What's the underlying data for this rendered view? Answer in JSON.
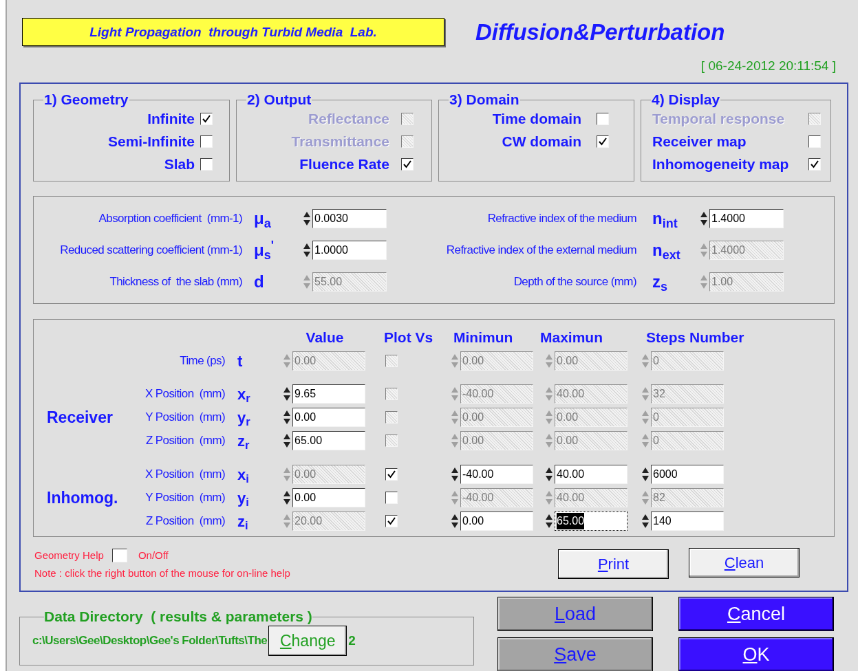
{
  "header": {
    "lab_title": "Light Propagation  through Turbid Media  Lab.",
    "app_title": "Diffusion&Perturbation",
    "timestamp": "[ 06-24-2012 20:11:54 ]"
  },
  "option_groups": [
    {
      "title": "1) Geometry",
      "items": [
        {
          "label": "Infinite",
          "checked": true,
          "disabled": false
        },
        {
          "label": "Semi-Infinite",
          "checked": false,
          "disabled": false
        },
        {
          "label": "Slab",
          "checked": false,
          "disabled": false
        }
      ]
    },
    {
      "title": "2) Output",
      "items": [
        {
          "label": "Reflectance",
          "checked": false,
          "disabled": true
        },
        {
          "label": "Transmittance",
          "checked": false,
          "disabled": true
        },
        {
          "label": "Fluence Rate",
          "checked": true,
          "disabled": false
        }
      ]
    },
    {
      "title": "3) Domain",
      "items": [
        {
          "label": "Time domain",
          "checked": false,
          "disabled": false
        },
        {
          "label": "CW domain",
          "checked": true,
          "disabled": false
        }
      ]
    },
    {
      "title": "4) Display",
      "items": [
        {
          "label": "Temporal response",
          "checked": false,
          "disabled": true
        },
        {
          "label": "Receiver map",
          "checked": false,
          "disabled": false
        },
        {
          "label": "Inhomogeneity map",
          "checked": true,
          "disabled": false
        }
      ]
    }
  ],
  "parameters": [
    {
      "label": "Absorption coefficient  (mm-1)",
      "symbol": "μ$_{a}$",
      "value": "0.0030",
      "disabled": false
    },
    {
      "label": "Refractive index of the medium",
      "symbol": "n$_{int}$",
      "value": "1.4000",
      "disabled": false
    },
    {
      "label": "Reduced scattering coefficient (mm-1)",
      "symbol": "μ$_{s}$$^{'}$",
      "value": "1.0000",
      "disabled": false
    },
    {
      "label": "Refractive index of the external medium",
      "symbol": "n$_{ext}$",
      "value": "1.4000",
      "disabled": true
    },
    {
      "label": "Thickness of  the slab (mm)",
      "symbol": "d",
      "value": "55.00",
      "disabled": true
    },
    {
      "label": "Depth of the source (mm)",
      "symbol": "z$_{s}$",
      "value": "1.00",
      "disabled": true
    }
  ],
  "table": {
    "columns": [
      "Value",
      "Plot Vs",
      "Minimun",
      "Maximun",
      "Steps Number"
    ],
    "sections": [
      {
        "rows": [
          {
            "label": "Time (ps)",
            "symbol": "t",
            "value": {
              "text": "0.00",
              "disabled": true
            },
            "plot_vs": {
              "checked": false,
              "disabled": true
            },
            "minimum": {
              "text": "0.00",
              "disabled": true
            },
            "maximum": {
              "text": "0.00",
              "disabled": true
            },
            "steps": {
              "text": "0",
              "disabled": true
            }
          }
        ]
      },
      {
        "title": "Receiver",
        "rows": [
          {
            "label": "X Position  (mm)",
            "symbol": "x$_{r}$",
            "value": {
              "text": "9.65",
              "disabled": false
            },
            "plot_vs": {
              "checked": false,
              "disabled": true
            },
            "minimum": {
              "text": "-40.00",
              "disabled": true
            },
            "maximum": {
              "text": "40.00",
              "disabled": true
            },
            "steps": {
              "text": "32",
              "disabled": true
            }
          },
          {
            "label": "Y Position  (mm)",
            "symbol": "y$_{r}$",
            "value": {
              "text": "0.00",
              "disabled": false
            },
            "plot_vs": {
              "checked": false,
              "disabled": true
            },
            "minimum": {
              "text": "0.00",
              "disabled": true
            },
            "maximum": {
              "text": "0.00",
              "disabled": true
            },
            "steps": {
              "text": "0",
              "disabled": true
            }
          },
          {
            "label": "Z Position  (mm)",
            "symbol": "z$_{r}$",
            "value": {
              "text": "65.00",
              "disabled": false
            },
            "plot_vs": {
              "checked": false,
              "disabled": true
            },
            "minimum": {
              "text": "0.00",
              "disabled": true
            },
            "maximum": {
              "text": "0.00",
              "disabled": true
            },
            "steps": {
              "text": "0",
              "disabled": true
            }
          }
        ]
      },
      {
        "title": "Inhomog.",
        "rows": [
          {
            "label": "X Position  (mm)",
            "symbol": "x$_{i}$",
            "value": {
              "text": "0.00",
              "disabled": true
            },
            "plot_vs": {
              "checked": true,
              "disabled": false
            },
            "minimum": {
              "text": "-40.00",
              "disabled": false
            },
            "maximum": {
              "text": "40.00",
              "disabled": false
            },
            "steps": {
              "text": "6000",
              "disabled": false
            }
          },
          {
            "label": "Y Position  (mm)",
            "symbol": "y$_{i}$",
            "value": {
              "text": "0.00",
              "disabled": false
            },
            "plot_vs": {
              "checked": false,
              "disabled": false
            },
            "minimum": {
              "text": "-40.00",
              "disabled": true
            },
            "maximum": {
              "text": "40.00",
              "disabled": true
            },
            "steps": {
              "text": "82",
              "disabled": true
            }
          },
          {
            "label": "Z Position  (mm)",
            "symbol": "z$_{i}$",
            "value": {
              "text": "20.00",
              "disabled": true
            },
            "plot_vs": {
              "checked": true,
              "disabled": false
            },
            "minimum": {
              "text": "0.00",
              "disabled": false
            },
            "maximum": {
              "text": "65.00",
              "disabled": false,
              "focused": true
            },
            "steps": {
              "text": "140",
              "disabled": false
            }
          }
        ]
      }
    ]
  },
  "footer": {
    "help_label": "Geometry Help",
    "help_checked": false,
    "help_state": "On/Off",
    "note": "Note : click the right button of the mouse for on-line help",
    "buttons": [
      {
        "accel": "P",
        "rest": "rint"
      },
      {
        "accel": "C",
        "rest": "lean"
      }
    ]
  },
  "data_directory": {
    "title": "Data Directory  ( results & parameters )",
    "path": "c:\\Users\\Gee\\Desktop\\Gee's Folder\\Tufts\\The",
    "change_button": {
      "accel": "C",
      "rest": "hange"
    },
    "path_tail": "2"
  },
  "actions": [
    {
      "accel": "L",
      "rest": "oad",
      "kind": "grey"
    },
    {
      "accel": "C",
      "rest": "ancel",
      "kind": "blue"
    },
    {
      "accel": "S",
      "rest": "ave",
      "kind": "grey"
    },
    {
      "accel": "O",
      "rest": "K",
      "kind": "blue"
    }
  ]
}
